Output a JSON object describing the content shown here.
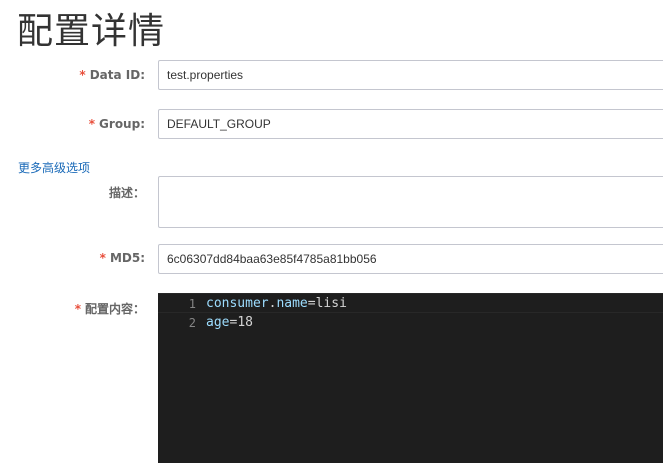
{
  "page": {
    "title": "配置详情"
  },
  "form": {
    "required_mark": "*",
    "data_id": {
      "label": "Data ID:",
      "value": "test.properties"
    },
    "group": {
      "label": "Group:",
      "value": "DEFAULT_GROUP"
    },
    "advanced_link": "更多高级选项",
    "description": {
      "label": "描述：",
      "value": ""
    },
    "md5": {
      "label": "MD5:",
      "value": "6c06307dd84baa63e85f4785a81bb056"
    },
    "content": {
      "label": "配置内容：",
      "lines": [
        {
          "number": "1",
          "key_a": "consumer",
          "dot": ".",
          "key_b": "name",
          "eq": "=",
          "value": "lisi"
        },
        {
          "number": "2",
          "key_a": "age",
          "eq": "=",
          "value": "18"
        }
      ]
    }
  },
  "colors": {
    "required": "#e84f3c",
    "link": "#1a6ab8",
    "editor_bg": "#1e1e1e",
    "editor_key": "#9cdcfe",
    "editor_text": "#d4d4d4",
    "editor_gutter": "#858585"
  }
}
